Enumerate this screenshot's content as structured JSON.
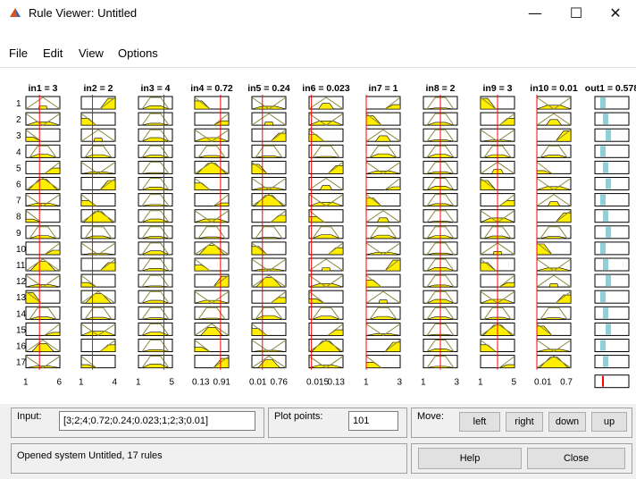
{
  "window": {
    "title": "Rule Viewer: Untitled",
    "minimize_glyph": "—",
    "maximize_glyph": "☐",
    "close_glyph": "✕"
  },
  "menu": [
    "File",
    "Edit",
    "View",
    "Options"
  ],
  "rule_numbers": [
    "1",
    "2",
    "3",
    "4",
    "5",
    "6",
    "7",
    "8",
    "9",
    "10",
    "11",
    "12",
    "13",
    "14",
    "15",
    "16",
    "17"
  ],
  "columns": [
    {
      "header": "in1 = 3",
      "min": "1",
      "max": "6",
      "line_frac": 0.4
    },
    {
      "header": "in2 = 2",
      "min": "1",
      "max": "4",
      "line_frac": 0.33
    },
    {
      "header": "in3 = 4",
      "min": "1",
      "max": "5",
      "line_frac": 0.75
    },
    {
      "header": "in4 = 0.72",
      "min": "0.13",
      "max": "0.91",
      "line_frac": 0.76
    },
    {
      "header": "in5 = 0.24",
      "min": "0.01",
      "max": "0.76",
      "line_frac": 0.31
    },
    {
      "header": "in6 = 0.023",
      "min": "0.015",
      "max": "0.13",
      "line_frac": 0.07
    },
    {
      "header": "in7 = 1",
      "min": "1",
      "max": "3",
      "line_frac": 0.0
    },
    {
      "header": "in8 = 2",
      "min": "1",
      "max": "3",
      "line_frac": 0.5
    },
    {
      "header": "in9 = 3",
      "min": "1",
      "max": "5",
      "line_frac": 0.5
    },
    {
      "header": "in10 = 0.01",
      "min": "0.01",
      "max": "0.7",
      "line_frac": 0.0
    },
    {
      "header": "out1 = 0.578",
      "min": "",
      "max": "",
      "line_frac": 0.55
    }
  ],
  "input": {
    "label": "Input:",
    "value": "[3;2;4;0.72;0.24;0.023;1;2;3;0.01]"
  },
  "plot_points": {
    "label": "Plot points:",
    "value": "101"
  },
  "move": {
    "label": "Move:",
    "left": "left",
    "right": "right",
    "down": "down",
    "up": "up"
  },
  "status": "Opened system Untitled, 17 rules",
  "help_label": "Help",
  "close_label": "Close",
  "colors": {
    "fill": "#ffee00",
    "curve": "#8c8a3c",
    "line": "#ff0000",
    "output_bar": "#8fd0d8"
  }
}
